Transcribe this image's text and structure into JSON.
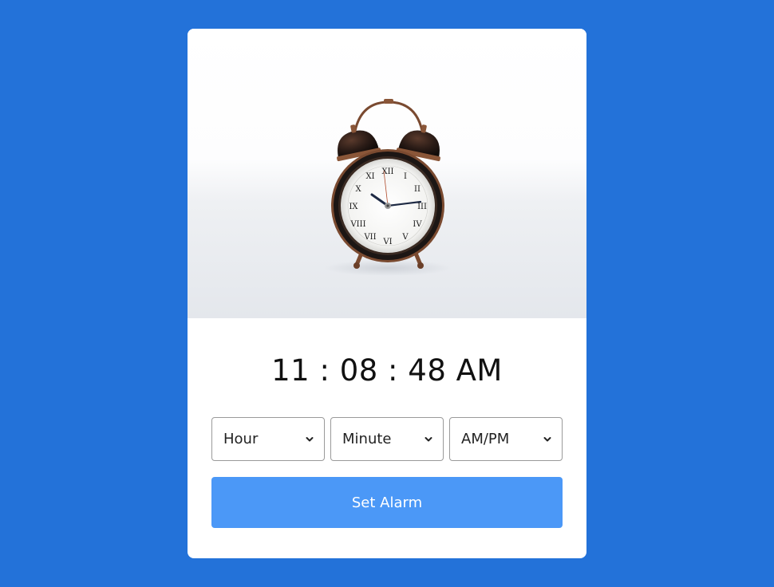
{
  "clock": {
    "time_display": "11 : 08 : 48 AM"
  },
  "alarm_form": {
    "hour_select": {
      "selected": "Hour"
    },
    "minute_select": {
      "selected": "Minute"
    },
    "ampm_select": {
      "selected": "AM/PM"
    },
    "set_button_label": "Set Alarm"
  },
  "colors": {
    "background": "#2372d9",
    "card": "#ffffff",
    "button": "#4b98f7",
    "button_text": "#ffffff"
  },
  "icons": {
    "select_arrow": "chevron-down-icon",
    "illustration": "alarm-clock-image"
  }
}
